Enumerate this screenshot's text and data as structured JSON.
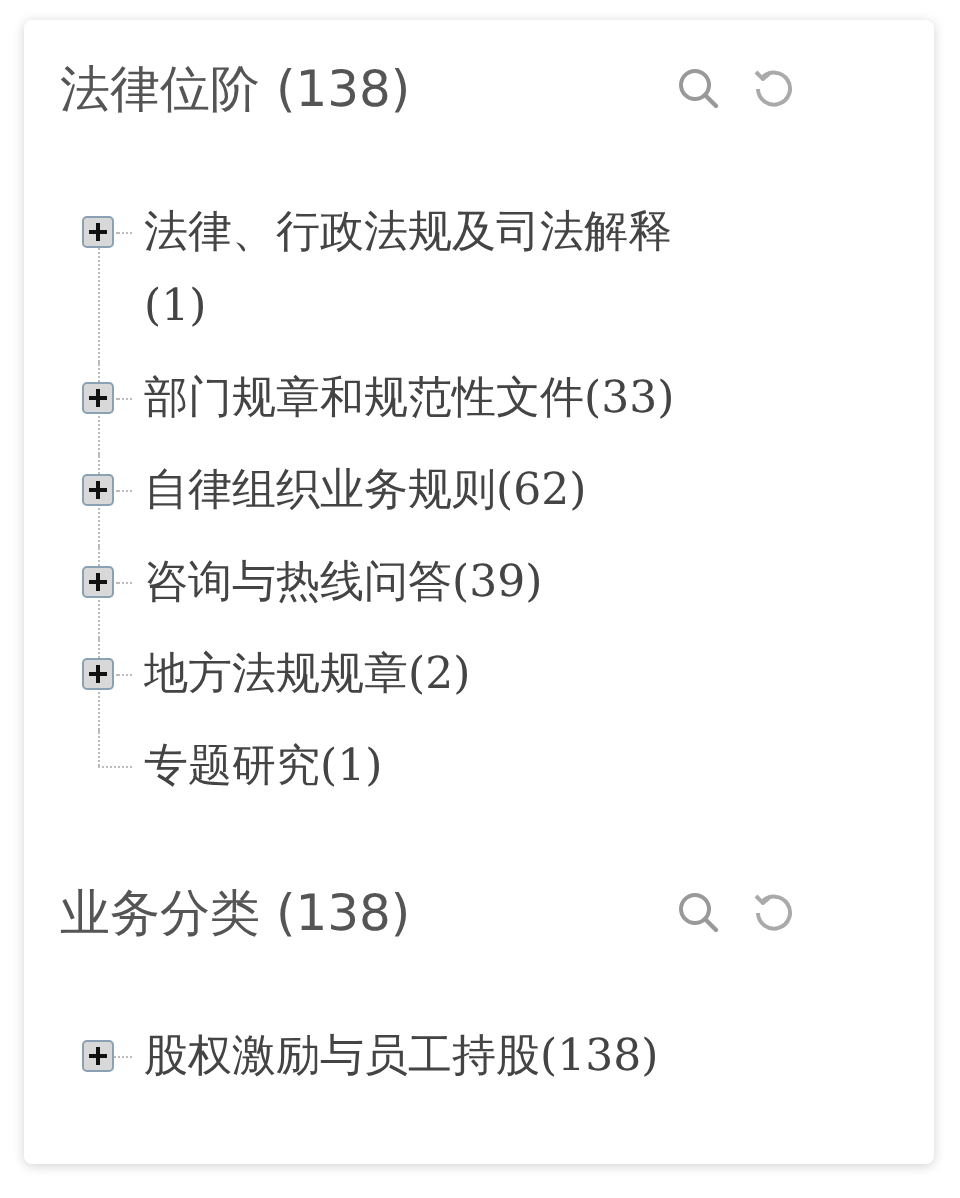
{
  "sections": [
    {
      "title": "法律位阶",
      "count": "(138)",
      "items": [
        {
          "kind": "branch",
          "label": "法律、行政法规及司法解释(1)"
        },
        {
          "kind": "branch",
          "label": "部门规章和规范性文件(33)"
        },
        {
          "kind": "branch",
          "label": "自律组织业务规则(62)"
        },
        {
          "kind": "branch",
          "label": "咨询与热线问答(39)"
        },
        {
          "kind": "branch",
          "label": "地方法规规章(2)"
        },
        {
          "kind": "leaf",
          "label": "专题研究(1)"
        }
      ]
    },
    {
      "title": "业务分类",
      "count": "(138)",
      "items": [
        {
          "kind": "branch",
          "label": "股权激励与员工持股(138)"
        }
      ]
    }
  ]
}
